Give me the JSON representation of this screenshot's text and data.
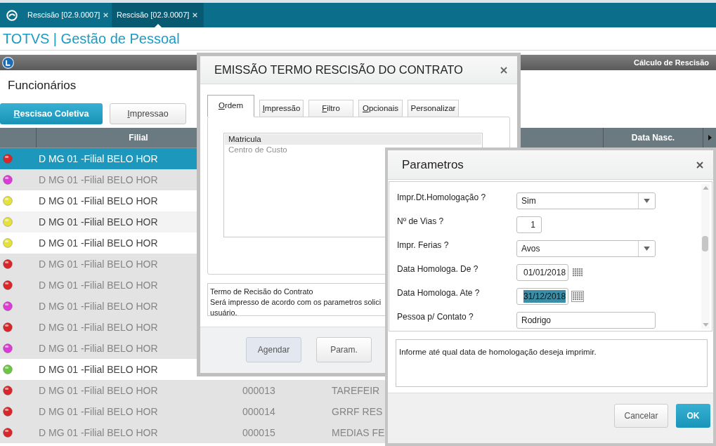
{
  "top_bar": {
    "tabs": [
      {
        "label": "Rescisão [02.9.0007]",
        "selected": false
      },
      {
        "label": "Rescisão [02.9.0007]",
        "selected": true
      }
    ]
  },
  "app_title": "TOTVS | Gestão de Pessoal",
  "module_bar": {
    "title": "Cálculo de Rescisão"
  },
  "page": {
    "title": "Funcionários",
    "buttons": [
      {
        "label": "Rescisao Coletiva",
        "kind": "primary",
        "mnemonic": true
      },
      {
        "label": "Impressao",
        "kind": "default",
        "mnemonic": true
      }
    ]
  },
  "table": {
    "columns": [
      {
        "label": "Filial"
      },
      {
        "label": "Data Nasc."
      }
    ],
    "rows": [
      {
        "color": "#d8262a",
        "filial": "D MG 01 -Filial BELO HOR",
        "selected": true,
        "disabled": false
      },
      {
        "color": "#dd3ad6",
        "filial": "D MG 01 -Filial BELO HOR",
        "selected": false,
        "disabled": true
      },
      {
        "color": "#e6e23c",
        "filial": "D MG 01 -Filial BELO HOR",
        "selected": false,
        "disabled": false
      },
      {
        "color": "#e6e23c",
        "filial": "D MG 01 -Filial BELO HOR",
        "selected": false,
        "disabled": false
      },
      {
        "color": "#e6e23c",
        "filial": "D MG 01 -Filial BELO HOR",
        "selected": false,
        "disabled": false
      },
      {
        "color": "#d8262a",
        "filial": "D MG 01 -Filial BELO HOR",
        "selected": false,
        "disabled": true
      },
      {
        "color": "#d8262a",
        "filial": "D MG 01 -Filial BELO HOR",
        "selected": false,
        "disabled": true
      },
      {
        "color": "#dd3ad6",
        "filial": "D MG 01 -Filial BELO HOR",
        "selected": false,
        "disabled": true
      },
      {
        "color": "#d8262a",
        "filial": "D MG 01 -Filial BELO HOR",
        "selected": false,
        "disabled": true
      },
      {
        "color": "#dd3ad6",
        "filial": "D MG 01 -Filial BELO HOR",
        "selected": false,
        "disabled": true
      },
      {
        "color": "#6cc644",
        "filial": "D MG 01 -Filial BELO HOR",
        "selected": false,
        "disabled": false
      },
      {
        "color": "#d8262a",
        "filial": "D MG 01 -Filial BELO HOR",
        "column_3": "000013",
        "column_4": "TAREFEIR",
        "selected": false,
        "disabled": true
      },
      {
        "color": "#d8262a",
        "filial": "D MG 01 -Filial BELO HOR",
        "column_3": "000014",
        "column_4": "GRRF RES",
        "selected": false,
        "disabled": true
      },
      {
        "color": "#d8262a",
        "filial": "D MG 01 -Filial BELO HOR",
        "column_3": "000015",
        "column_4": "MEDIAS FE",
        "selected": false,
        "disabled": true
      }
    ]
  },
  "emission_dialog": {
    "title": "EMISSÃO TERMO RESCISÃO DO CONTRATO",
    "tabs": [
      {
        "label": "Ordem",
        "selected": true,
        "mnemonic": true
      },
      {
        "label": "Impressão",
        "selected": false,
        "mnemonic": true
      },
      {
        "label": "Filtro",
        "selected": false,
        "mnemonic": true
      },
      {
        "label": "Opcionais",
        "selected": false,
        "mnemonic": true
      },
      {
        "label": "Personalizar",
        "selected": false,
        "mnemonic": false
      }
    ],
    "order_list": {
      "items": [
        {
          "label": "Matricula",
          "selected": true
        },
        {
          "label": "Centro de Custo",
          "selected": false
        }
      ]
    },
    "description": {
      "lines": [
        "Termo de Recisão do Contrato",
        "Será impresso de acordo com os parametros solici",
        "usuário."
      ]
    },
    "buttons": [
      {
        "label": "Agendar",
        "focused": true
      },
      {
        "label": "Param.",
        "focused": false
      }
    ]
  },
  "params_dialog": {
    "title": "Parametros",
    "fields": [
      {
        "label": "Impr.Dt.Homologação ?",
        "kind": "select",
        "value": "Sim",
        "focused": false
      },
      {
        "label": "Nº de Vias ?",
        "kind": "number",
        "value": "1",
        "focused": false
      },
      {
        "label": "Impr. Ferias ?",
        "kind": "select",
        "value": "Avos",
        "focused": false
      },
      {
        "label": "Data Homologa. De ?",
        "kind": "date",
        "value": "01/01/2018",
        "focused": false
      },
      {
        "label": "Data Homologa. Ate ?",
        "kind": "date",
        "value": "31/12/2018",
        "focused": true
      },
      {
        "label": "Pessoa p/ Contato ?",
        "kind": "text",
        "value": "Rodrigo",
        "focused": false
      }
    ],
    "help": "Informe até qual data de homologação deseja imprimir.",
    "buttons": [
      {
        "label": "Cancelar",
        "kind": "default"
      },
      {
        "label": "OK",
        "kind": "primary"
      }
    ]
  }
}
